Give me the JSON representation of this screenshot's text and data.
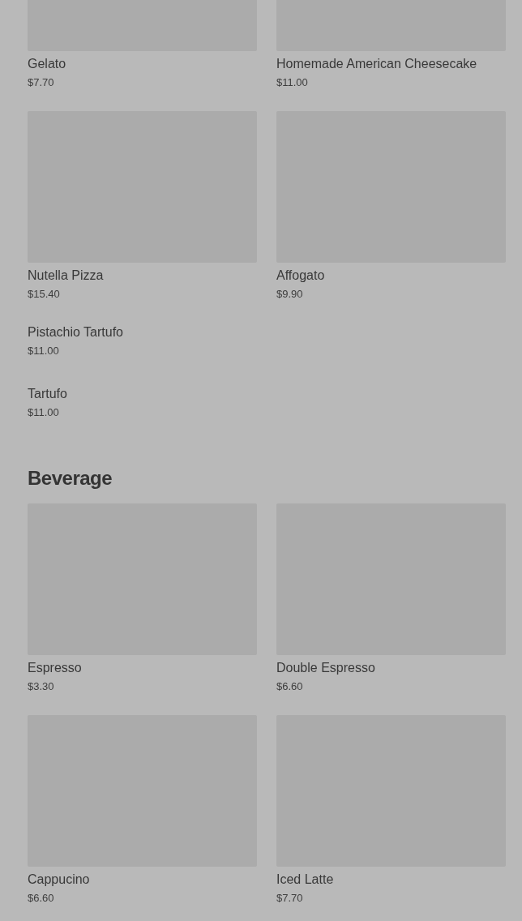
{
  "sections": [
    {
      "items": [
        {
          "kind": "with_image",
          "name": "Gelato",
          "price": "$7.70"
        },
        {
          "kind": "with_image",
          "name": "Homemade American Cheesecake",
          "price": "$11.00"
        },
        {
          "kind": "with_image",
          "name": "Nutella Pizza",
          "price": "$15.40"
        },
        {
          "kind": "with_image",
          "name": "Affogato",
          "price": "$9.90"
        },
        {
          "kind": "text_only",
          "name": "Pistachio Tartufo",
          "price": "$11.00"
        },
        {
          "kind": "text_only",
          "name": "Tartufo",
          "price": "$11.00"
        }
      ]
    },
    {
      "heading": "Beverage",
      "items": [
        {
          "kind": "with_image",
          "name": "Espresso",
          "price": "$3.30"
        },
        {
          "kind": "with_image",
          "name": "Double Espresso",
          "price": "$6.60"
        },
        {
          "kind": "with_image",
          "name": "Cappucino",
          "price": "$6.60"
        },
        {
          "kind": "with_image",
          "name": "Iced Latte",
          "price": "$7.70"
        }
      ]
    }
  ]
}
